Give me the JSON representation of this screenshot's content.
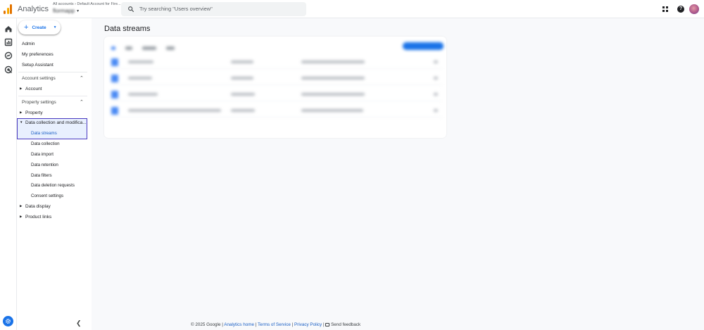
{
  "app": {
    "title": "Analytics"
  },
  "account": {
    "breadcrumb_account": "All accounts",
    "breadcrumb_property": "Default Account for Fire...",
    "property_name": "flormapp"
  },
  "search": {
    "placeholder": "Try searching \"Users overview\""
  },
  "create": {
    "label": "Create"
  },
  "nav": {
    "admin": "Admin",
    "my_preferences": "My preferences",
    "setup_assistant": "Setup Assistant",
    "account_settings": "Account settings",
    "account": "Account",
    "property_settings": "Property settings",
    "property": "Property",
    "data_collection": "Data collection and modifica...",
    "data_collection_items": [
      "Data streams",
      "Data collection",
      "Data import",
      "Data retention",
      "Data filters",
      "Data deletion requests",
      "Consent settings"
    ],
    "data_display": "Data display",
    "product_links": "Product links"
  },
  "main": {
    "title": "Data streams"
  },
  "footer": {
    "copyright": "© 2025 Google |",
    "analytics_home": "Analytics home",
    "terms": "Terms of Service",
    "privacy": "Privacy Policy",
    "send_feedback": "Send feedback"
  },
  "colors": {
    "accent": "#1a73e8",
    "highlight_border": "#4838c0",
    "highlight_bg": "#e8f0fe"
  },
  "icons": [
    "analytics-logo",
    "search-icon",
    "apps-grid-icon",
    "help-icon",
    "avatar",
    "home-icon",
    "reports-icon",
    "explore-icon",
    "advertising-icon",
    "admin-gear-icon",
    "collapse-chevron-icon",
    "feedback-icon"
  ]
}
